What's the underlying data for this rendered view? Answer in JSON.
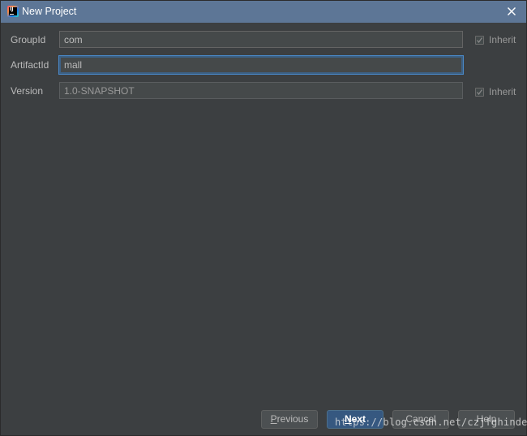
{
  "window": {
    "title": "New Project",
    "accent": "#5d7696",
    "background": "#3c3f41"
  },
  "form": {
    "group_id": {
      "label": "GroupId",
      "value": "com",
      "inherit_label": "Inherit",
      "inherit_checked": true
    },
    "artifact_id": {
      "label": "ArtifactId",
      "value": "mall"
    },
    "version": {
      "label": "Version",
      "value": "1.0-SNAPSHOT",
      "inherit_label": "Inherit",
      "inherit_checked": true
    }
  },
  "buttons": {
    "previous": {
      "mnemonic": "P",
      "rest": "revious"
    },
    "next": {
      "mnemonic": "N",
      "rest": "ext"
    },
    "cancel": {
      "label": "Cancel"
    },
    "help": {
      "label": "Help"
    }
  },
  "watermark": "https://blog.csdn.net/czjfghindey"
}
